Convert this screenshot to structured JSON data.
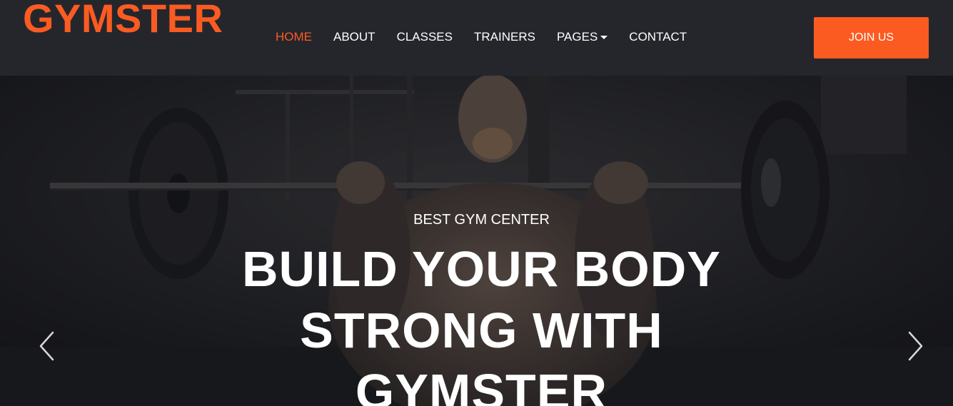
{
  "brand": {
    "name": "GYMSTER",
    "accent_color": "#fb5b21"
  },
  "nav": {
    "items": [
      {
        "label": "HOME",
        "active": true
      },
      {
        "label": "ABOUT",
        "active": false
      },
      {
        "label": "CLASSES",
        "active": false
      },
      {
        "label": "TRAINERS",
        "active": false
      },
      {
        "label": "PAGES",
        "active": false,
        "has_dropdown": true
      },
      {
        "label": "CONTACT",
        "active": false
      }
    ],
    "cta_label": "JOIN US"
  },
  "hero": {
    "subtitle": "BEST GYM CENTER",
    "title_lines": [
      "BUILD YOUR BODY",
      "STRONG WITH",
      "GYMSTER"
    ],
    "prev_icon": "chevron-left-icon",
    "next_icon": "chevron-right-icon"
  }
}
